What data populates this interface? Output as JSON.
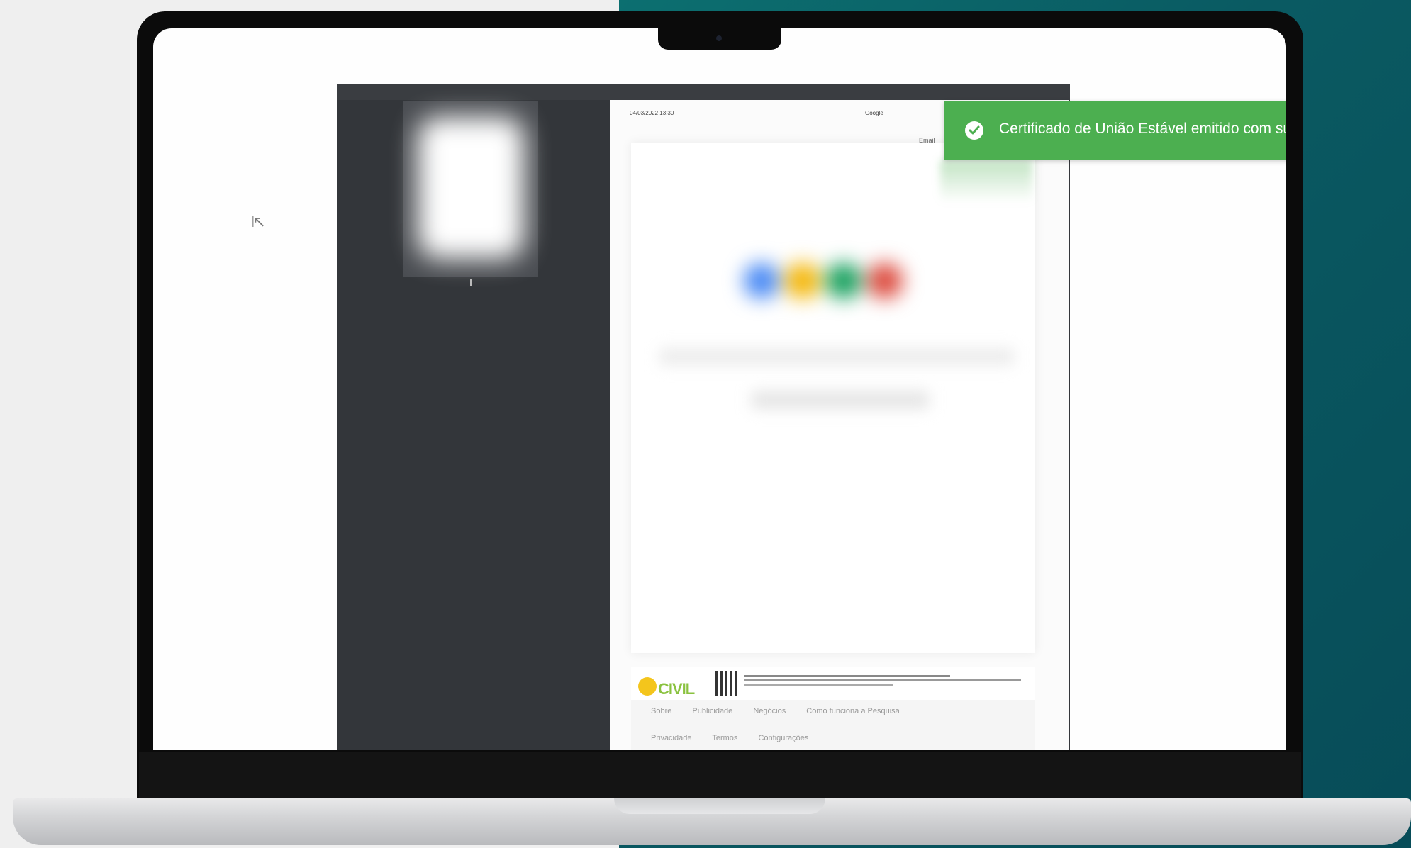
{
  "toast": {
    "message": "Certificado de União Estável emitido com suc",
    "icon": "check-circle-icon",
    "color": "#4caf50"
  },
  "document": {
    "header_left": "04/03/2022 13:30",
    "header_right": "Google",
    "email_label": "Email"
  },
  "footer": {
    "brand": "CIVIL",
    "links_row1": [
      "Sobre",
      "Publicidade",
      "Negócios",
      "Como funciona a Pesquisa"
    ],
    "links_row2": [
      "Privacidade",
      "Termos",
      "Configurações"
    ]
  },
  "colors": {
    "background_teal": "#0a5a62",
    "viewer_dark": "#34373b"
  }
}
